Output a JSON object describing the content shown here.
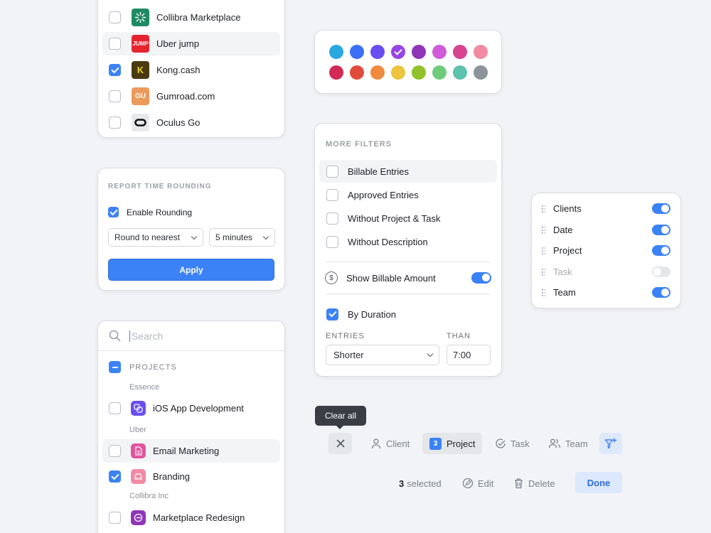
{
  "apps": [
    {
      "name": "Collibra Marketplace",
      "checked": false,
      "logo_text": "",
      "logo_color": "#1f8a63",
      "hover": false
    },
    {
      "name": "Uber jump",
      "checked": false,
      "logo_text": "JUMP",
      "logo_color": "#e62430",
      "hover": true
    },
    {
      "name": "Kong.cash",
      "checked": true,
      "logo_text": "K",
      "logo_color": "#4a3a12",
      "hover": false
    },
    {
      "name": "Gumroad.com",
      "checked": false,
      "logo_text": "GU",
      "logo_color": "#eb9a5c",
      "hover": false
    },
    {
      "name": "Oculus Go",
      "checked": false,
      "logo_text": "",
      "logo_color": "#e8e9ec",
      "hover": false
    }
  ],
  "colors": [
    "#2aa8e0",
    "#3b6ff5",
    "#6a4ef0",
    "#9645e6",
    "#8f36b8",
    "#cf5cd8",
    "#d8438f",
    "#f28aa4",
    "#d02a55",
    "#e04c3c",
    "#ef8a3e",
    "#ecc43e",
    "#92c22a",
    "#6ecb7a",
    "#5fc2ae",
    "#8c939b"
  ],
  "selected_color_index": 3,
  "rounding": {
    "title": "REPORT TIME ROUNDING",
    "enable_label": "Enable Rounding",
    "round_select": "Round to nearest",
    "minutes_select": "5 minutes",
    "apply_label": "Apply"
  },
  "projects": {
    "search_placeholder": "Search",
    "header": "PROJECTS",
    "group1": "Essence",
    "item1": "iOS App Development",
    "group2": "Uber",
    "item2": "Email Marketing",
    "item3": "Branding",
    "group3": "Collibra Inc",
    "item4": "Marketplace Redesign"
  },
  "filters": {
    "title": "MORE FILTERS",
    "billable": "Billable Entries",
    "approved": "Approved Entries",
    "without_project": "Without Project & Task",
    "without_description": "Without Description",
    "show_billable": "Show Billable Amount",
    "by_duration": "By Duration",
    "entries_label": "ENTRIES",
    "than_label": "THAN",
    "entries_value": "Shorter",
    "than_value": "7:00"
  },
  "columns": [
    {
      "name": "Clients",
      "on": true
    },
    {
      "name": "Date",
      "on": true
    },
    {
      "name": "Project",
      "on": true
    },
    {
      "name": "Task",
      "on": false
    },
    {
      "name": "Team",
      "on": true
    }
  ],
  "toolbar": {
    "tooltip": "Clear all",
    "client": "Client",
    "project_count": "3",
    "project": "Project",
    "task": "Task",
    "team": "Team"
  },
  "actions": {
    "selected_count": "3",
    "selected_label": "selected",
    "edit": "Edit",
    "delete": "Delete",
    "done": "Done"
  }
}
